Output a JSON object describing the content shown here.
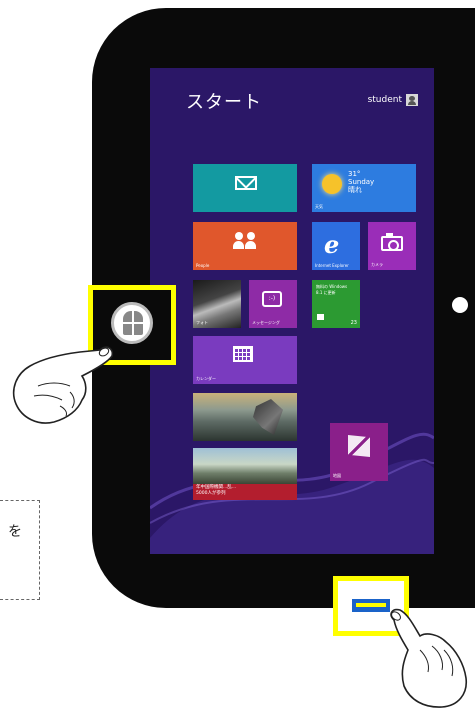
{
  "screen": {
    "title": "スタート",
    "user": "student"
  },
  "tiles": {
    "mail": {
      "label": ""
    },
    "weather": {
      "temp": "31°",
      "line2": "Sunday",
      "line3": "晴れ",
      "label": "天気"
    },
    "people": {
      "label": "People"
    },
    "ie": {
      "label": "Internet Explorer"
    },
    "camera": {
      "label": "カメラ"
    },
    "photos": {
      "label": "フォト"
    },
    "messaging": {
      "label": "メッセージング"
    },
    "store": {
      "line1": "無料の Windows",
      "line2": "8.1 に更新",
      "badge": "23"
    },
    "calendar": {
      "label": "カレンダー"
    },
    "desktop": {
      "label": ""
    },
    "news": {
      "line1": "年中国際機関...乱...",
      "line2": "5000人が参列"
    },
    "maps": {
      "label": "地図"
    }
  },
  "callout": {
    "text": "を"
  },
  "colors": {
    "screen_bg": "#2b1767",
    "highlight": "#ffff00",
    "bezel": "#0a0a0a"
  },
  "icons": {
    "start_button": "windows-start-icon",
    "home_key": "home-key-icon",
    "hand_left": "pointing-hand-icon",
    "hand_right": "pointing-hand-icon"
  }
}
